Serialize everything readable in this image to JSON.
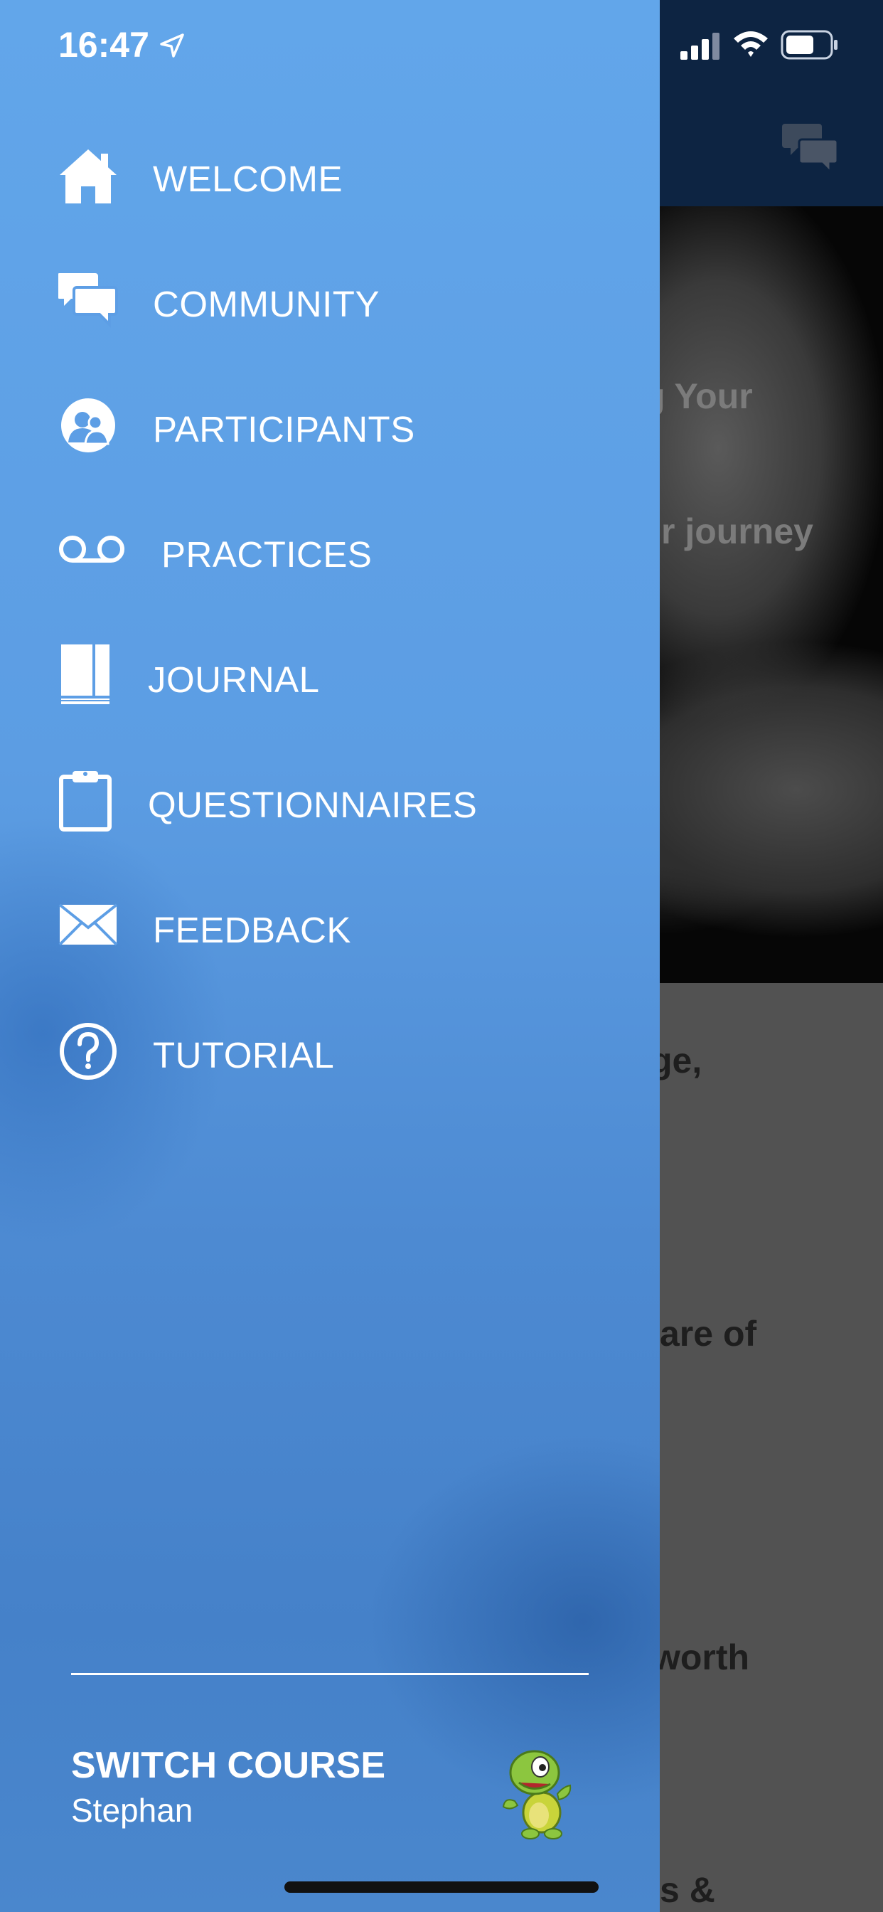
{
  "status_bar": {
    "time": "16:47",
    "icons": [
      "location-arrow-icon",
      "signal-icon",
      "wifi-icon",
      "battery-icon"
    ]
  },
  "drawer": {
    "menu": [
      {
        "label": "WELCOME",
        "icon": "home-icon"
      },
      {
        "label": "COMMUNITY",
        "icon": "chat-bubbles-icon"
      },
      {
        "label": "PARTICIPANTS",
        "icon": "participants-icon"
      },
      {
        "label": "PRACTICES",
        "icon": "voicemail-icon"
      },
      {
        "label": "JOURNAL",
        "icon": "book-icon"
      },
      {
        "label": "QUESTIONNAIRES",
        "icon": "clipboard-icon"
      },
      {
        "label": "FEEDBACK",
        "icon": "envelope-icon"
      },
      {
        "label": "TUTORIAL",
        "icon": "question-circle-icon"
      }
    ],
    "footer": {
      "switch_course": "SWITCH COURSE",
      "user_name": "Stephan",
      "mascot_icon": "turtle-mascot-icon"
    }
  },
  "background_app": {
    "header_icon": "chat-bubbles-icon",
    "hero_title_fragment": "g Your",
    "hero_subtitle_fragment": "r journey",
    "cells": [
      "ge,",
      "are of",
      "worth",
      "s &"
    ]
  },
  "colors": {
    "drawer_top": "#62a6ea",
    "drawer_bottom": "#4581c9",
    "header": "#0d2442",
    "text": "#ffffff"
  }
}
